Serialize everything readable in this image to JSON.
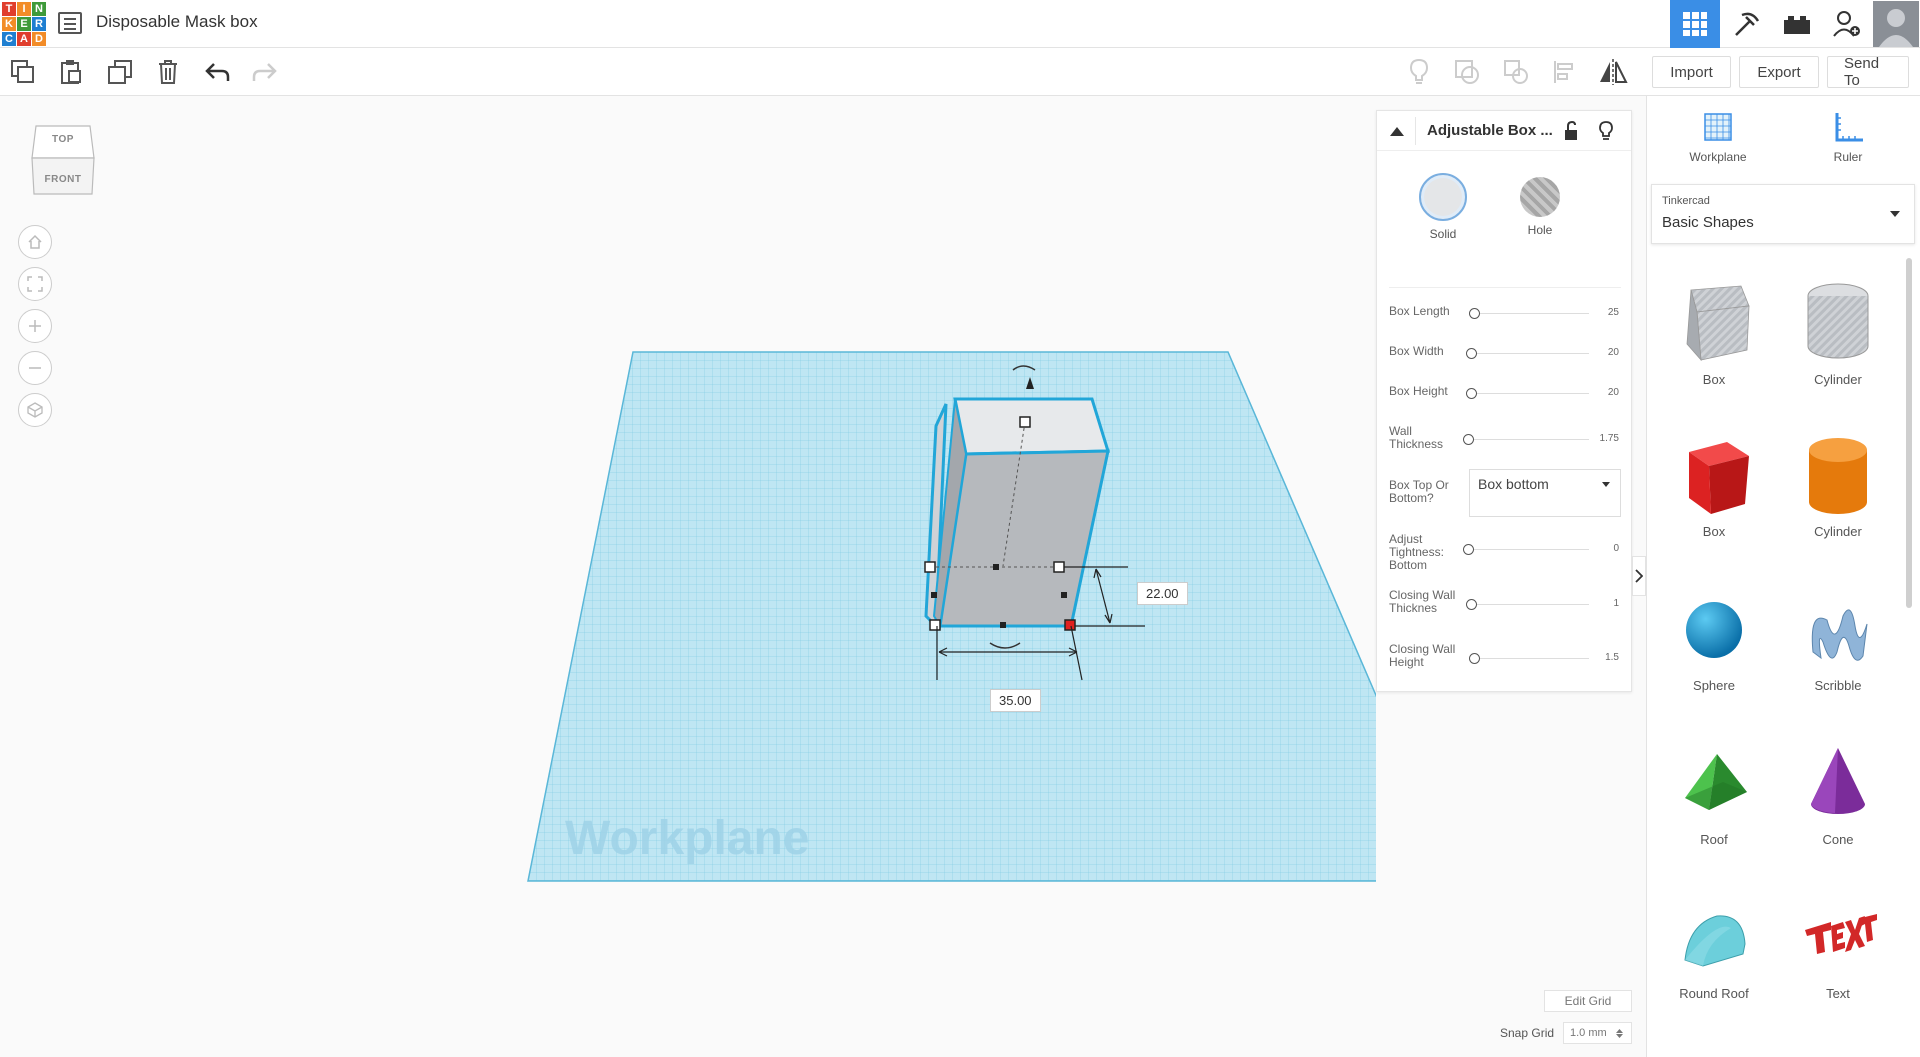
{
  "app": {
    "logo_letters": [
      "T",
      "I",
      "N",
      "K",
      "E",
      "R",
      "C",
      "A",
      "D"
    ],
    "document_title": "Disposable Mask box"
  },
  "toolbar": {
    "import_label": "Import",
    "export_label": "Export",
    "send_to_label": "Send To"
  },
  "viewcube": {
    "top": "TOP",
    "front": "FRONT"
  },
  "canvas": {
    "workplane_watermark": "Workplane",
    "dimension_width": "35.00",
    "dimension_depth": "22.00"
  },
  "inspector": {
    "title": "Adjustable Box ...",
    "solid_label": "Solid",
    "hole_label": "Hole",
    "params": [
      {
        "label": "Box Length",
        "value": "25"
      },
      {
        "label": "Box Width",
        "value": "20"
      },
      {
        "label": "Box Height",
        "value": "20"
      },
      {
        "label": "Wall Thickness",
        "value": "1.75"
      },
      {
        "label": "Adjust Tightness: Bottom",
        "value": "0"
      },
      {
        "label": "Closing Wall Thicknes",
        "value": "1"
      },
      {
        "label": "Closing Wall Height",
        "value": "1.5"
      }
    ],
    "select_label": "Box Top Or Bottom?",
    "select_value": "Box bottom"
  },
  "right_panel": {
    "workplane_label": "Workplane",
    "ruler_label": "Ruler",
    "library_source": "Tinkercad",
    "library_name": "Basic Shapes",
    "shapes": [
      {
        "label": "Box",
        "color": "#b0b4ba"
      },
      {
        "label": "Cylinder",
        "color": "#b0b4ba"
      },
      {
        "label": "Box",
        "color": "#e02020"
      },
      {
        "label": "Cylinder",
        "color": "#f08010"
      },
      {
        "label": "Sphere",
        "color": "#1a9ad6"
      },
      {
        "label": "Scribble",
        "color": "#8fb4d8"
      },
      {
        "label": "Roof",
        "color": "#2f9e3a"
      },
      {
        "label": "Cone",
        "color": "#7b2c9a"
      },
      {
        "label": "Round Roof",
        "color": "#5cc0cc"
      },
      {
        "label": "Text",
        "color": "#d22828"
      }
    ]
  },
  "footer": {
    "edit_grid_label": "Edit Grid",
    "snap_grid_label": "Snap Grid",
    "snap_grid_value": "1.0 mm"
  },
  "colors": {
    "accent": "#3a8ee6",
    "workplane": "#9fd8ec",
    "selection_outline": "#21a6d8"
  }
}
